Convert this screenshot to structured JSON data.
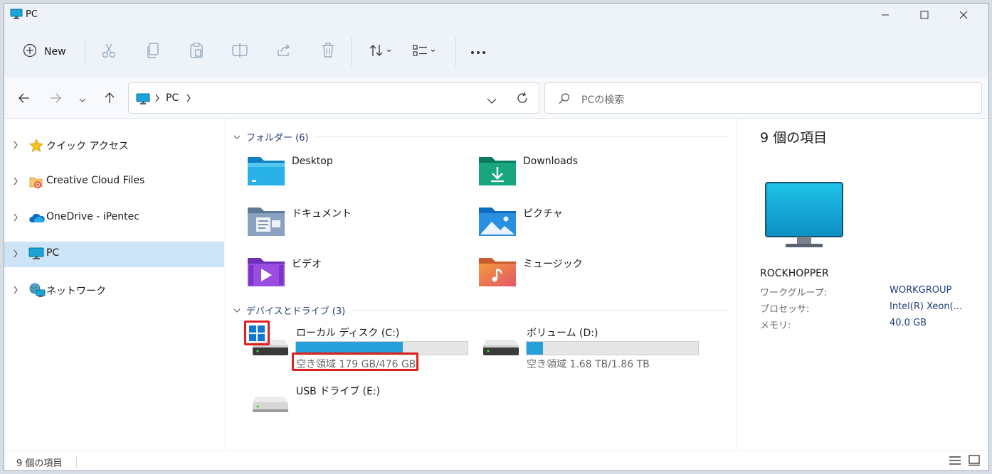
{
  "window": {
    "title": "PC"
  },
  "toolbar": {
    "new_label": "New",
    "icons": [
      "cut-icon",
      "copy-icon",
      "paste-icon",
      "rename-icon",
      "share-icon",
      "delete-icon",
      "sort-icon",
      "view-icon",
      "more-icon"
    ]
  },
  "address": {
    "root": "PC",
    "search_placeholder": "PCの検索"
  },
  "sidebar": {
    "items": [
      {
        "label": "クイック アクセス",
        "icon": "star-icon",
        "selected": false
      },
      {
        "label": "Creative Cloud Files",
        "icon": "creative-cloud-icon",
        "selected": false
      },
      {
        "label": "OneDrive - iPentec",
        "icon": "onedrive-cloud-icon",
        "selected": false
      },
      {
        "label": "PC",
        "icon": "pc-monitor-icon",
        "selected": true
      },
      {
        "label": "ネットワーク",
        "icon": "network-icon",
        "selected": false
      }
    ]
  },
  "folders": {
    "header": "フォルダー (6)",
    "items": [
      {
        "label": "Desktop",
        "icon": "desktop-folder-icon"
      },
      {
        "label": "Downloads",
        "icon": "downloads-folder-icon"
      },
      {
        "label": "ドキュメント",
        "icon": "documents-folder-icon"
      },
      {
        "label": "ピクチャ",
        "icon": "pictures-folder-icon"
      },
      {
        "label": "ビデオ",
        "icon": "videos-folder-icon"
      },
      {
        "label": "ミュージック",
        "icon": "music-folder-icon"
      }
    ]
  },
  "drives": {
    "header": "デバイスとドライブ (3)",
    "items": [
      {
        "label": "ローカル ディスク (C:)",
        "free": "空き領域 179 GB/476 GB",
        "used_fraction": 0.624,
        "icon": "system-drive-icon"
      },
      {
        "label": "ボリューム (D:)",
        "free": "空き領域 1.68 TB/1.86 TB",
        "used_fraction": 0.097,
        "icon": "hard-drive-icon"
      },
      {
        "label": "USB ドライブ (E:)",
        "free": "",
        "used_fraction": null,
        "icon": "usb-drive-icon"
      }
    ]
  },
  "details": {
    "title": "9 個の項目",
    "computer_name": "ROCKHOPPER",
    "properties": [
      {
        "key": "ワークグループ:",
        "value": "WORKGROUP"
      },
      {
        "key": "プロセッサ:",
        "value": "Intel(R) Xeon(..."
      },
      {
        "key": "メモリ:",
        "value": "40.0 GB"
      }
    ]
  },
  "status": {
    "count": "9 個の項目"
  },
  "colors": {
    "accent": "#26a0da",
    "selected": "#cde4f7",
    "annotation": "#e02020",
    "link": "#1f3d7a"
  }
}
